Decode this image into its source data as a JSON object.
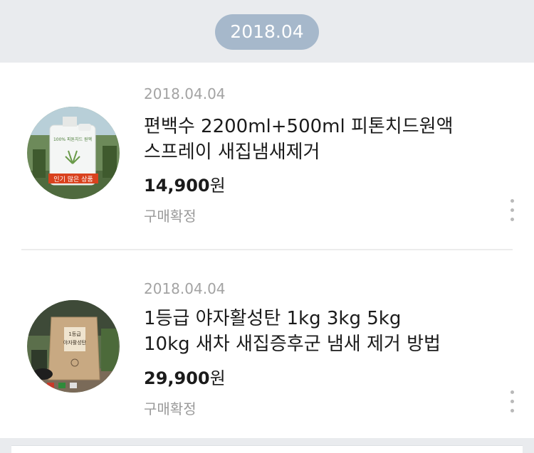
{
  "header": {
    "date_group": "2018.04"
  },
  "orders": [
    {
      "date": "2018.04.04",
      "title_line1": "편백수 2200ml+500ml 피톤치드원액",
      "title_line2": "스프레이 새집냄새제거",
      "price": "14,900",
      "currency": "원",
      "status": "구매확정",
      "thumb_label": "인기 많은 상품",
      "thumb_bottle_label": "100% 피톤치드 원액",
      "menu_icon": "more-vertical-icon"
    },
    {
      "date": "2018.04.04",
      "title_line1": "1등급 야자활성탄 1kg 3kg 5kg",
      "title_line2": "10kg 새차 새집증후군 냄새 제거 방법",
      "price": "29,900",
      "currency": "원",
      "status": "구매확정",
      "thumb_bag_label_1": "1등급",
      "thumb_bag_label_2": "야자활성탄",
      "menu_icon": "more-vertical-icon"
    }
  ]
}
